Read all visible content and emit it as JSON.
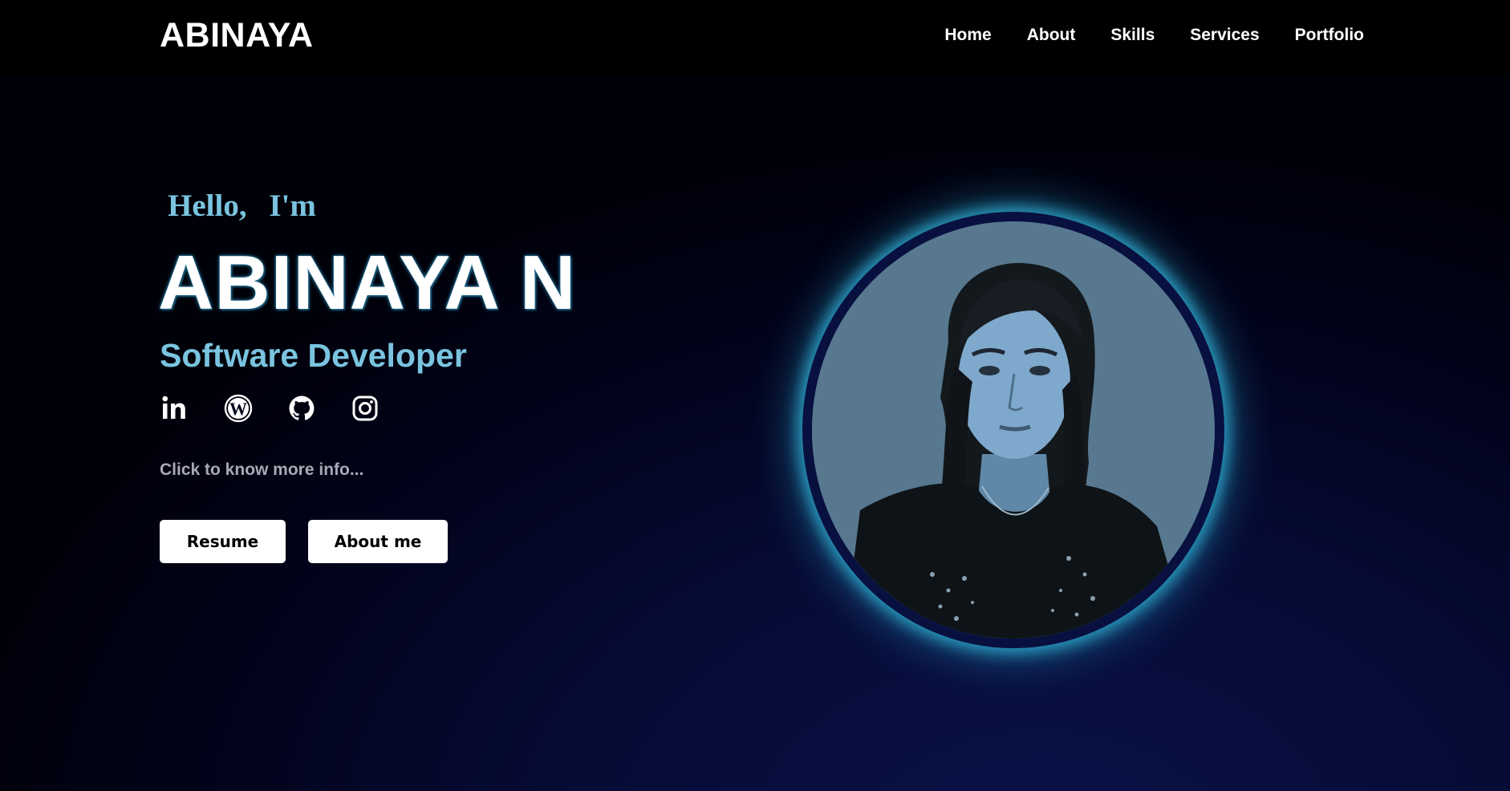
{
  "header": {
    "brand": "ABINAYA",
    "nav": [
      "Home",
      "About",
      "Skills",
      "Services",
      "Portfolio"
    ]
  },
  "hero": {
    "greeting": "Hello, I'm",
    "name": "ABINAYA N",
    "role": "Software Developer",
    "socials": [
      "linkedin-icon",
      "wordpress-icon",
      "github-icon",
      "instagram-icon"
    ],
    "info": "Click to know more info...",
    "buttons": {
      "resume": "Resume",
      "about": "About me"
    }
  },
  "colors": {
    "accent": "#7ac4e0",
    "glow": "#2a9cc0",
    "background": "#02031a",
    "button_bg": "#ffffff"
  }
}
